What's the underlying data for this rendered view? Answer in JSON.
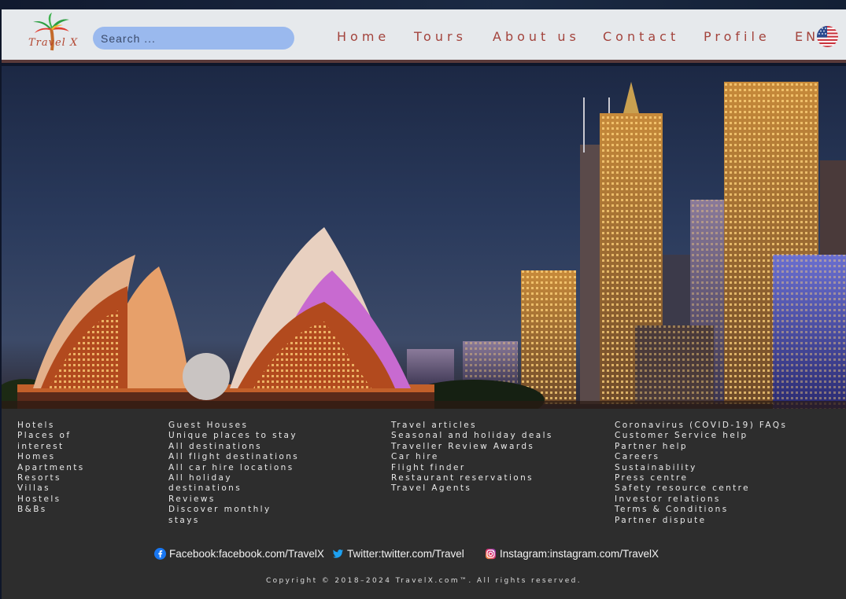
{
  "brand": {
    "logo_text": "Travel X"
  },
  "search": {
    "placeholder": "Search ..."
  },
  "nav": {
    "items": [
      "Home",
      "Tours",
      "About us",
      "Contact",
      "Profile"
    ],
    "language": "EN"
  },
  "footer": {
    "columns": [
      [
        "Hotels",
        "Places of",
        "interest",
        "Homes",
        "Apartments",
        "Resorts",
        "Villas",
        "Hostels",
        "B&Bs"
      ],
      [
        "Guest Houses",
        "Unique places to stay",
        "All destinations",
        "All flight destinations",
        "All car hire locations",
        "All holiday",
        "destinations",
        "Reviews",
        "Discover monthly",
        "stays"
      ],
      [
        "Travel articles",
        "Seasonal and holiday deals",
        "Traveller Review Awards",
        "Car hire",
        "Flight finder",
        "Restaurant reservations",
        "Travel Agents"
      ],
      [
        "Coronavirus (COVID-19) FAQs",
        "Customer Service help",
        "Partner help",
        "Careers",
        "Sustainability",
        "Press centre",
        "Safety resource centre",
        "Investor relations",
        "Terms & Conditions",
        "Partner dispute"
      ]
    ],
    "social": {
      "facebook": "Facebook:facebook.com/TravelX",
      "twitter": "Twitter:twitter.com/Travel",
      "instagram": "Instagram:instagram.com/TravelX"
    },
    "copyright": "Copyright © 2018–2024 TravelX.com™. All rights reserved."
  },
  "colors": {
    "nav_text": "#a3433c",
    "search_bg": "#9ab9ee",
    "footer_bg": "#2d2d2d",
    "navbar_bg": "#e6e9ec"
  }
}
